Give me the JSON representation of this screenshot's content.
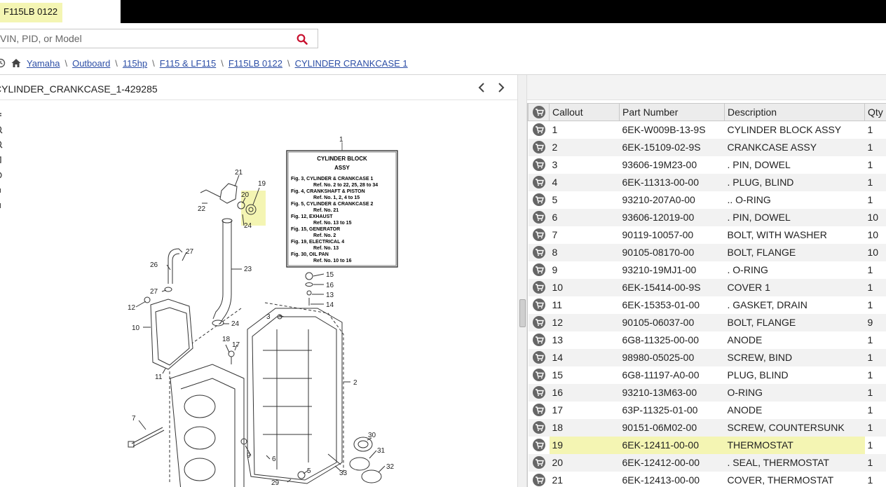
{
  "header": {
    "model_tab": "F115LB 0122"
  },
  "search": {
    "placeholder": "VIN, PID, or Model",
    "icon": "search-icon"
  },
  "breadcrumb": {
    "icons": [
      "history-icon",
      "home-icon"
    ],
    "items": [
      "Yamaha",
      "Outboard",
      "115hp",
      "F115 & LF115",
      "F115LB 0122",
      "CYLINDER CRANKCASE 1"
    ],
    "separator": "\\"
  },
  "diagram": {
    "title": "CYLINDER_CRANKCASE_1-429285",
    "ref_box": {
      "title_line1": "CYLINDER BLOCK",
      "title_line2": "ASSY",
      "lines": [
        "Fig. 3, CYLINDER & CRANKCASE 1",
        "Ref. No. 2 to 22, 25, 28 to 34",
        "Fig. 4, CRANKSHAFT & PISTON",
        "Ref. No. 1, 2, 4 to 15",
        "Fig. 5, CYLINDER & CRANKCASE 2",
        "Ref. No. 21",
        "Fig. 12, EXHAUST",
        "Ref. No. 13 to 15",
        "Fig. 15, GENERATOR",
        "Ref. No. 2",
        "Fig. 19, ELECTRICAL 4",
        "Ref. No. 13",
        "Fig. 30, OIL PAN",
        "Ref. No. 10 to 16"
      ]
    },
    "callouts": [
      "1",
      "2",
      "3",
      "5",
      "6",
      "7",
      "9",
      "10",
      "11",
      "12",
      "13",
      "14",
      "15",
      "16",
      "17",
      "18",
      "19",
      "20",
      "21",
      "22",
      "23",
      "24",
      "24",
      "26",
      "27",
      "27",
      "29",
      "30",
      "31",
      "32",
      "33"
    ],
    "highlight_color": "#f4f5b3"
  },
  "parts_table": {
    "columns": [
      "Callout",
      "Part Number",
      "Description",
      "Qty"
    ],
    "selected_callout": "19",
    "rows": [
      {
        "callout": "1",
        "part": "6EK-W009B-13-9S",
        "desc": "CYLINDER BLOCK ASSY",
        "qty": "1"
      },
      {
        "callout": "2",
        "part": "6EK-15109-02-9S",
        "desc": "CRANKCASE ASSY",
        "qty": "1"
      },
      {
        "callout": "3",
        "part": "93606-19M23-00",
        "desc": ". PIN, DOWEL",
        "qty": "1"
      },
      {
        "callout": "4",
        "part": "6EK-11313-00-00",
        "desc": ". PLUG, BLIND",
        "qty": "1"
      },
      {
        "callout": "5",
        "part": "93210-207A0-00",
        "desc": ".. O-RING",
        "qty": "1"
      },
      {
        "callout": "6",
        "part": "93606-12019-00",
        "desc": ". PIN, DOWEL",
        "qty": "10"
      },
      {
        "callout": "7",
        "part": "90119-10057-00",
        "desc": "BOLT, WITH WASHER",
        "qty": "10"
      },
      {
        "callout": "8",
        "part": "90105-08170-00",
        "desc": "BOLT, FLANGE",
        "qty": "10"
      },
      {
        "callout": "9",
        "part": "93210-19MJ1-00",
        "desc": ". O-RING",
        "qty": "1"
      },
      {
        "callout": "10",
        "part": "6EK-15414-00-9S",
        "desc": "COVER 1",
        "qty": "1"
      },
      {
        "callout": "11",
        "part": "6EK-15353-01-00",
        "desc": ". GASKET, DRAIN",
        "qty": "1"
      },
      {
        "callout": "12",
        "part": "90105-06037-00",
        "desc": "BOLT, FLANGE",
        "qty": "9"
      },
      {
        "callout": "13",
        "part": "6G8-11325-00-00",
        "desc": "ANODE",
        "qty": "1"
      },
      {
        "callout": "14",
        "part": "98980-05025-00",
        "desc": "SCREW, BIND",
        "qty": "1"
      },
      {
        "callout": "15",
        "part": "6G8-11197-A0-00",
        "desc": "PLUG, BLIND",
        "qty": "1"
      },
      {
        "callout": "16",
        "part": "93210-13M63-00",
        "desc": "O-RING",
        "qty": "1"
      },
      {
        "callout": "17",
        "part": "63P-11325-01-00",
        "desc": "ANODE",
        "qty": "1"
      },
      {
        "callout": "18",
        "part": "90151-06M02-00",
        "desc": "SCREW, COUNTERSUNK",
        "qty": "1"
      },
      {
        "callout": "19",
        "part": "6EK-12411-00-00",
        "desc": "THERMOSTAT",
        "qty": "1"
      },
      {
        "callout": "20",
        "part": "6EK-12412-00-00",
        "desc": ". SEAL, THERMOSTAT",
        "qty": "1"
      },
      {
        "callout": "21",
        "part": "6EK-12413-00-00",
        "desc": "COVER, THERMOSTAT",
        "qty": "1"
      }
    ]
  }
}
